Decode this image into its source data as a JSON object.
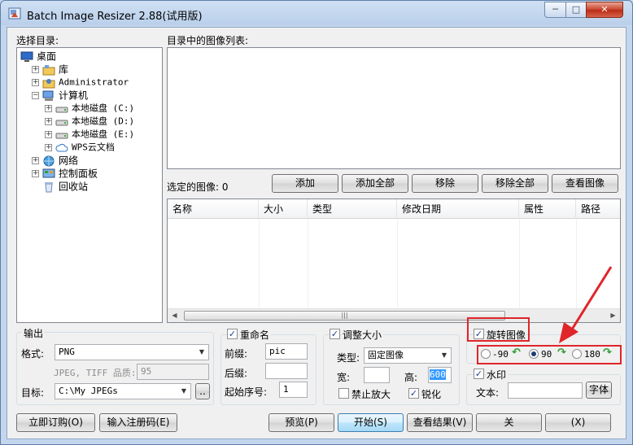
{
  "window": {
    "title": "Batch Image Resizer 2.88(试用版)",
    "controls": {
      "minimize": "─",
      "maximize": "□",
      "close": "✕"
    }
  },
  "left": {
    "dir_label": "选择目录:",
    "tree": [
      {
        "label": "桌面",
        "icon": "desktop-icon",
        "level": 0,
        "expander": ""
      },
      {
        "label": "库",
        "icon": "library-icon",
        "level": 1,
        "expander": "+"
      },
      {
        "label": "Administrator",
        "icon": "user-folder-icon",
        "level": 1,
        "expander": "+"
      },
      {
        "label": "计算机",
        "icon": "computer-icon",
        "level": 1,
        "expander": "−"
      },
      {
        "label": "本地磁盘 (C:)",
        "icon": "drive-icon",
        "level": 2,
        "expander": "+"
      },
      {
        "label": "本地磁盘 (D:)",
        "icon": "drive-icon",
        "level": 2,
        "expander": "+"
      },
      {
        "label": "本地磁盘 (E:)",
        "icon": "drive-icon",
        "level": 2,
        "expander": "+"
      },
      {
        "label": "WPS云文档",
        "icon": "cloud-icon",
        "level": 2,
        "expander": "+"
      },
      {
        "label": "网络",
        "icon": "network-icon",
        "level": 1,
        "expander": "+"
      },
      {
        "label": "控制面板",
        "icon": "control-panel-icon",
        "level": 1,
        "expander": "+"
      },
      {
        "label": "回收站",
        "icon": "recycle-bin-icon",
        "level": 1,
        "expander": ""
      }
    ]
  },
  "right": {
    "image_list_label": "目录中的图像列表:",
    "selected_label": "选定的图像: 0",
    "buttons": {
      "add": "添加",
      "add_all": "添加全部",
      "remove": "移除",
      "remove_all": "移除全部",
      "view": "查看图像"
    },
    "columns": [
      "名称",
      "大小",
      "类型",
      "修改日期",
      "属性",
      "路径"
    ]
  },
  "output": {
    "title": "输出",
    "format_label": "格式:",
    "format_value": "PNG",
    "quality_label": "JPEG, TIFF 品质:",
    "quality_value": "95",
    "target_label": "目标:",
    "target_value": "C:\\My JPEGs",
    "browse": ".."
  },
  "rename": {
    "title": "重命名",
    "checked": true,
    "prefix_label": "前缀:",
    "prefix_value": "pic",
    "suffix_label": "后缀:",
    "suffix_value": "",
    "start_label": "起始序号:",
    "start_value": "1"
  },
  "resize": {
    "title": "调整大小",
    "checked": true,
    "type_label": "类型:",
    "type_value": "固定图像",
    "width_label": "宽:",
    "width_value": "",
    "height_label": "高:",
    "height_value": "600",
    "no_enlarge": "禁止放大",
    "no_enlarge_checked": false,
    "sharpen": "锐化",
    "sharpen_checked": true
  },
  "rotate": {
    "title": "旋转图像",
    "checked": true,
    "options": [
      "-90",
      "90",
      "180"
    ],
    "selected": "90"
  },
  "watermark": {
    "title": "水印",
    "checked": true,
    "text_label": "文本:",
    "text_value": "",
    "font_button": "字体"
  },
  "bottom": {
    "buy": "立即订购(O)",
    "register": "输入注册码(E)",
    "preview": "预览(P)",
    "start": "开始(S)",
    "results": "查看结果(V)",
    "about": "关",
    "exit": "(X)"
  },
  "colors": {
    "highlight": "#e0252b",
    "accent": "#3c7fb1"
  }
}
